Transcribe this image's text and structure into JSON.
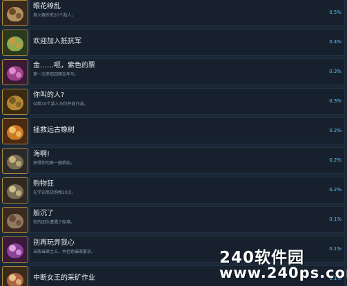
{
  "achievements": [
    {
      "title": "眼花缭乱",
      "desc": "用火器杀死20个敌人。",
      "percent": "0.5%",
      "icon": "tree-spirit-icon",
      "colors": [
        "#3a2a1c",
        "#c8a36a",
        "#6b4a2a"
      ]
    },
    {
      "title": "欢迎加入抵抗军",
      "desc": "",
      "percent": "0.4%",
      "icon": "goblin-icon",
      "colors": [
        "#2b3a1c",
        "#9fbf5a",
        "#c89a46"
      ]
    },
    {
      "title": "金……呃，紫色的票",
      "desc": "第一次参观四嗝岛年华。",
      "percent": "0.3%",
      "icon": "purple-hat-icon",
      "colors": [
        "#3b1a33",
        "#b04a9a",
        "#e08bcf"
      ]
    },
    {
      "title": "你叫的人?",
      "desc": "召唤10个敌人与你并肩作战。",
      "percent": "0.3%",
      "icon": "bell-icon",
      "colors": [
        "#3a2a12",
        "#c99a3a",
        "#7a5a22"
      ]
    },
    {
      "title": "拯救远古橡树",
      "desc": "",
      "percent": "0.2%",
      "icon": "ancient-oak-icon",
      "colors": [
        "#4a2a12",
        "#e08a2a",
        "#f2c26a"
      ]
    },
    {
      "title": "海啊!",
      "desc": "获得你的第一艘帆船。",
      "percent": "0.2%",
      "icon": "ship-icon",
      "colors": [
        "#2a2a2a",
        "#8a7a5a",
        "#c8b47a"
      ]
    },
    {
      "title": "购物狂",
      "desc": "在学识商店购物20次。",
      "percent": "0.2%",
      "icon": "shop-cart-icon",
      "colors": [
        "#2e2a22",
        "#8a7a5a",
        "#d0c090"
      ]
    },
    {
      "title": "船沉了",
      "desc": "你的团队遭遇了船难。",
      "percent": "0.1%",
      "icon": "shipwreck-icon",
      "colors": [
        "#3a2a22",
        "#a08a6a",
        "#6a4a3a"
      ]
    },
    {
      "title": "别再玩弄我心",
      "desc": "击败璀璨之王，并拒绝璀璨要求。",
      "percent": "0.1%",
      "icon": "jester-icon",
      "colors": [
        "#3a1a3a",
        "#9a4aaa",
        "#e0a0e0"
      ]
    },
    {
      "title": "中断女王的采矿作业",
      "desc": "",
      "percent": "0.1%",
      "icon": "mining-queen-icon",
      "colors": [
        "#3a2a1a",
        "#c0704a",
        "#e8c08a"
      ]
    }
  ],
  "watermark": {
    "line1": "240软件园",
    "line2": "www.240ps.com"
  }
}
